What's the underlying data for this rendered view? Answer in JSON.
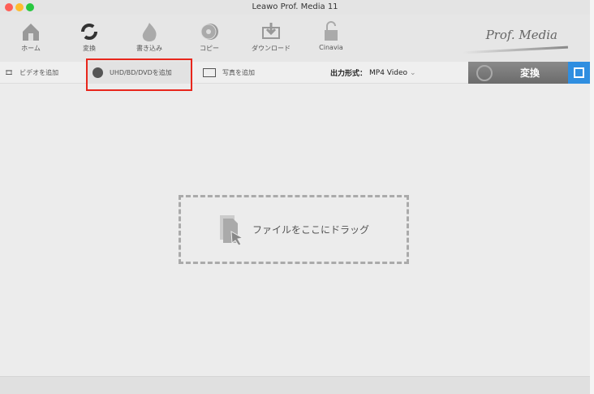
{
  "window": {
    "title": "Leawo Prof. Media 11"
  },
  "toolbar": {
    "items": [
      {
        "label": "ホーム"
      },
      {
        "label": "変換"
      },
      {
        "label": "書き込み"
      },
      {
        "label": "コピー"
      },
      {
        "label": "ダウンロード"
      },
      {
        "label": "Cinavia"
      }
    ],
    "logo": "Prof. Media"
  },
  "subbar": {
    "add_video": "ビデオを追加",
    "add_disc": "UHD/BD/DVDを追加",
    "add_photo": "写真を追加",
    "output_label": "出力形式：",
    "output_value": "MP4 Video",
    "convert": "変換"
  },
  "dropzone": {
    "text": "ファイルをここにドラッグ"
  }
}
